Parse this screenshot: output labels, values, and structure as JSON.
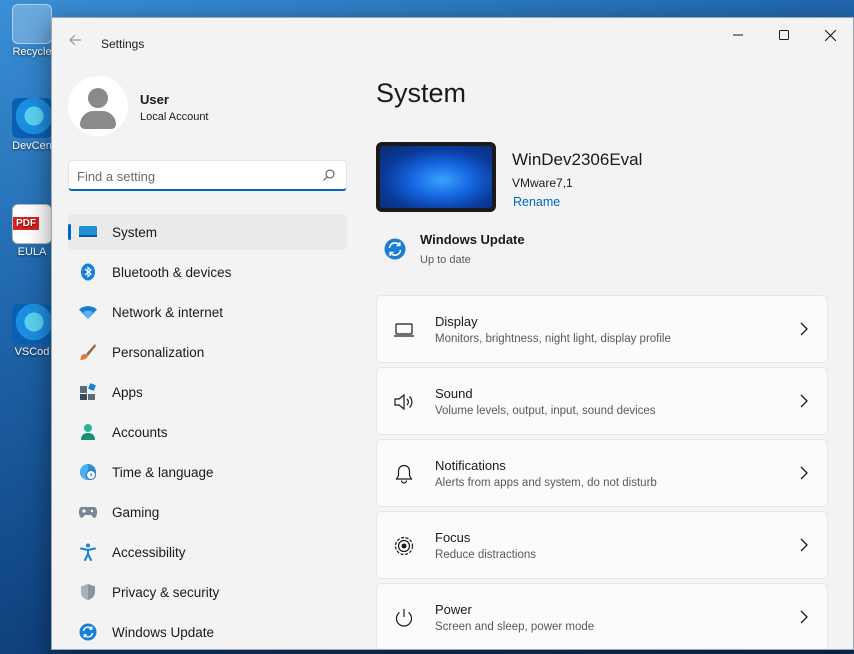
{
  "desktop": {
    "icons": [
      {
        "label": "Recycle"
      },
      {
        "label": "DevCen"
      },
      {
        "label": "EULA"
      },
      {
        "label": "VSCod"
      }
    ],
    "pdf_badge": "PDF"
  },
  "window": {
    "title": "Settings",
    "controls": {
      "minimize": "–",
      "maximize": "☐",
      "close": "✕"
    }
  },
  "profile": {
    "name": "User",
    "account_type": "Local Account"
  },
  "search": {
    "placeholder": "Find a setting"
  },
  "nav": {
    "items": [
      {
        "label": "System",
        "icon": "system-icon",
        "active": true
      },
      {
        "label": "Bluetooth & devices",
        "icon": "bluetooth-icon"
      },
      {
        "label": "Network & internet",
        "icon": "wifi-icon"
      },
      {
        "label": "Personalization",
        "icon": "brush-icon"
      },
      {
        "label": "Apps",
        "icon": "apps-icon"
      },
      {
        "label": "Accounts",
        "icon": "person-icon"
      },
      {
        "label": "Time & language",
        "icon": "globe-clock-icon"
      },
      {
        "label": "Gaming",
        "icon": "gamepad-icon"
      },
      {
        "label": "Accessibility",
        "icon": "accessibility-icon"
      },
      {
        "label": "Privacy & security",
        "icon": "shield-icon"
      },
      {
        "label": "Windows Update",
        "icon": "update-icon"
      }
    ]
  },
  "main": {
    "title": "System",
    "device": {
      "name": "WinDev2306Eval",
      "model": "VMware7,1",
      "rename_label": "Rename"
    },
    "windows_update": {
      "title": "Windows Update",
      "status": "Up to date"
    },
    "cards": [
      {
        "title": "Display",
        "subtitle": "Monitors, brightness, night light, display profile",
        "icon": "monitor-icon"
      },
      {
        "title": "Sound",
        "subtitle": "Volume levels, output, input, sound devices",
        "icon": "speaker-icon"
      },
      {
        "title": "Notifications",
        "subtitle": "Alerts from apps and system, do not disturb",
        "icon": "bell-icon"
      },
      {
        "title": "Focus",
        "subtitle": "Reduce distractions",
        "icon": "focus-icon"
      },
      {
        "title": "Power",
        "subtitle": "Screen and sleep, power mode",
        "icon": "power-icon"
      }
    ]
  },
  "colors": {
    "accent": "#0067c0",
    "window_bg": "#f3f3f3",
    "card_bg": "#fbfbfb"
  }
}
